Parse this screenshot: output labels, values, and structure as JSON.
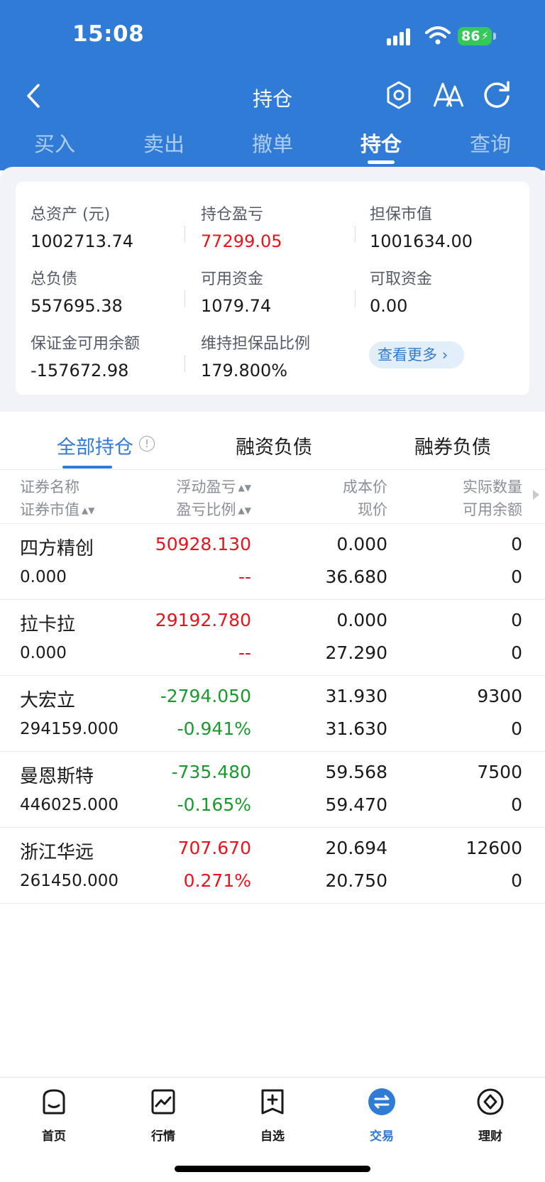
{
  "status_bar": {
    "time": "15:08",
    "battery": "86"
  },
  "nav": {
    "title": "持仓"
  },
  "top_tabs": [
    "买入",
    "卖出",
    "撤单",
    "持仓",
    "查询"
  ],
  "active_top_tab": 3,
  "summary": {
    "total_assets_label": "总资产 (元)",
    "total_assets": "1002713.74",
    "position_pl_label": "持仓盈亏",
    "position_pl": "77299.05",
    "collateral_label": "担保市值",
    "collateral": "1001634.00",
    "total_liability_label": "总负债",
    "total_liability": "557695.38",
    "available_funds_label": "可用资金",
    "available_funds": "1079.74",
    "withdrawable_label": "可取资金",
    "withdrawable": "0.00",
    "margin_balance_label": "保证金可用余额",
    "margin_balance": "-157672.98",
    "maintenance_ratio_label": "维持担保品比例",
    "maintenance_ratio": "179.800%",
    "more_label": "查看更多"
  },
  "sub_tabs": [
    "全部持仓",
    "融资负债",
    "融券负债"
  ],
  "table_header": {
    "name": "证券名称",
    "market_value": "证券市值",
    "float_pl": "浮动盈亏",
    "pl_ratio": "盈亏比例",
    "cost": "成本价",
    "price": "现价",
    "qty": "实际数量",
    "avail": "可用余额"
  },
  "rows": [
    {
      "name": "四方精创",
      "market_value": "0.000",
      "float_pl": "50928.130",
      "pl_ratio": "--",
      "cost": "0.000",
      "price": "36.680",
      "qty": "0",
      "avail": "0",
      "trend": "up"
    },
    {
      "name": "拉卡拉",
      "market_value": "0.000",
      "float_pl": "29192.780",
      "pl_ratio": "--",
      "cost": "0.000",
      "price": "27.290",
      "qty": "0",
      "avail": "0",
      "trend": "up"
    },
    {
      "name": "大宏立",
      "market_value": "294159.000",
      "float_pl": "-2794.050",
      "pl_ratio": "-0.941%",
      "cost": "31.930",
      "price": "31.630",
      "qty": "9300",
      "avail": "0",
      "trend": "down"
    },
    {
      "name": "曼恩斯特",
      "market_value": "446025.000",
      "float_pl": "-735.480",
      "pl_ratio": "-0.165%",
      "cost": "59.568",
      "price": "59.470",
      "qty": "7500",
      "avail": "0",
      "trend": "down"
    },
    {
      "name": "浙江华远",
      "market_value": "261450.000",
      "float_pl": "707.670",
      "pl_ratio": "0.271%",
      "cost": "20.694",
      "price": "20.750",
      "qty": "12600",
      "avail": "0",
      "trend": "up"
    }
  ],
  "bottom_nav": [
    "首页",
    "行情",
    "自选",
    "交易",
    "理财"
  ],
  "active_bottom_nav": 3,
  "colors": {
    "brand": "#2f7bd6",
    "up": "#e8141c",
    "down": "#1a9a2e"
  }
}
